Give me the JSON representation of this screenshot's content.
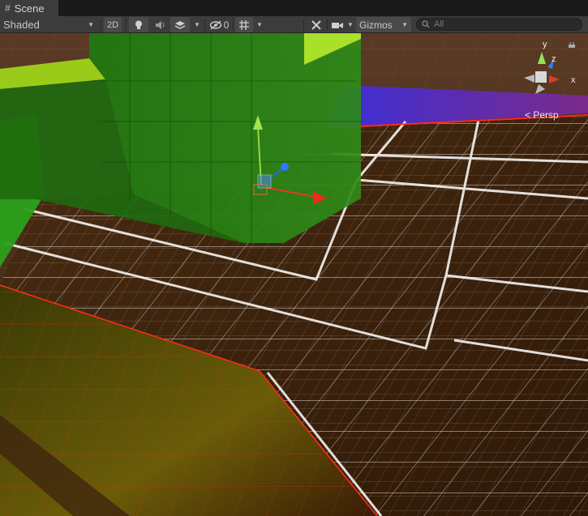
{
  "window": {
    "tab_label": "Scene",
    "tab_icon": "scene-grid-icon"
  },
  "toolbar": {
    "draw_mode": "Shaded",
    "mode_2d": "2D",
    "lighting_icon": "lightbulb-icon",
    "audio_icon": "speaker-icon",
    "effects_icon": "layers-icon",
    "hidden_count": "0",
    "hidden_icon": "eye-slash-icon",
    "grid_icon": "grid-icon",
    "tools_icon": "wrench-icon",
    "camera_icon": "camera-icon",
    "gizmos_label": "Gizmos",
    "search_placeholder": "All"
  },
  "viewport": {
    "projection": "Persp",
    "axis_labels": {
      "x": "x",
      "y": "y",
      "z": "z"
    },
    "colors": {
      "green": "#3b8f1e",
      "floor": "#3a200b",
      "grid_line": "#ffffff",
      "red_line": "#ff2a1a",
      "purple": "#5a2fd1"
    }
  }
}
